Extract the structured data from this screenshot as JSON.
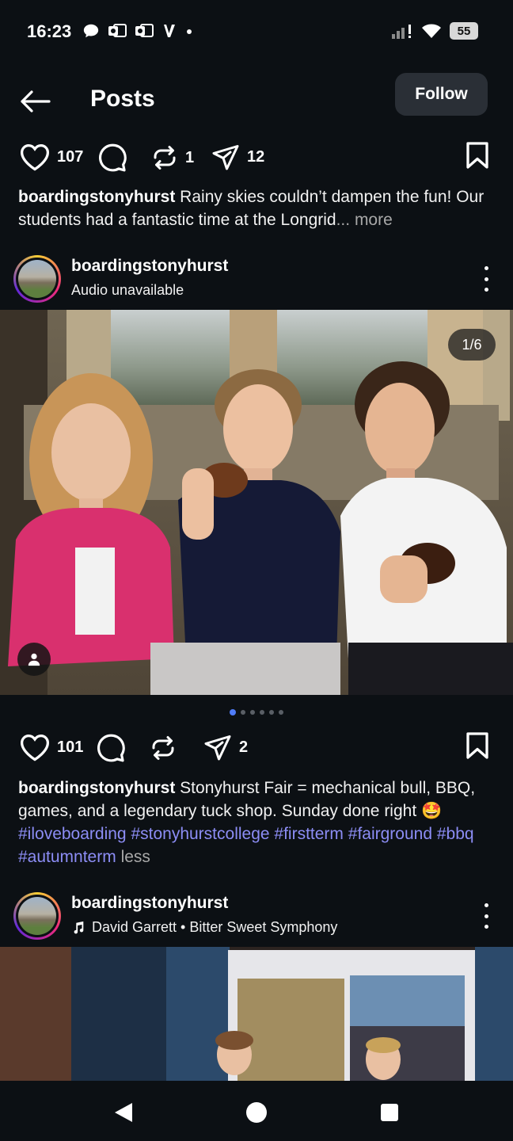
{
  "status_bar": {
    "time": "16:23",
    "battery": "55",
    "left_icons": [
      "chat-bubble-icon",
      "outlook-icon",
      "outlook-icon",
      "v-app-icon",
      "dot-icon"
    ],
    "right_icons": [
      "signal-icon",
      "wifi-icon",
      "battery-icon"
    ]
  },
  "header": {
    "title": "Posts",
    "follow_label": "Follow"
  },
  "post1_actions": {
    "likes": "107",
    "reposts": "1",
    "shares": "12"
  },
  "post1_caption": {
    "username": "boardingstonyhurst",
    "text": " Rainy skies couldn’t dampen the fun! Our students had a fantastic time at the Longrid",
    "ellipsis": "...",
    "more_label": " more"
  },
  "post2": {
    "username": "boardingstonyhurst",
    "subtitle": "Audio unavailable",
    "image_counter": "1/6",
    "likes": "101",
    "shares": "2",
    "caption_username": "boardingstonyhurst",
    "caption_text": " Stonyhurst Fair = mechanical bull, BBQ, games, and a legendary tuck shop. Sunday done right 🤩",
    "hashtags": [
      "#iloveboarding",
      "#stonyhurstcollege",
      "#firstterm",
      "#fairground",
      "#bbq",
      "#autumnterm"
    ],
    "less_label": "less"
  },
  "post3": {
    "username": "boardingstonyhurst",
    "music": "David Garrett • Bitter Sweet Symphony"
  },
  "carousel": {
    "total": 6,
    "active": 1
  },
  "colors": {
    "background": "#0c1014",
    "follow_button": "#2a2f36",
    "hashtag": "#8c8df5",
    "carousel_active": "#4f7cf7"
  }
}
